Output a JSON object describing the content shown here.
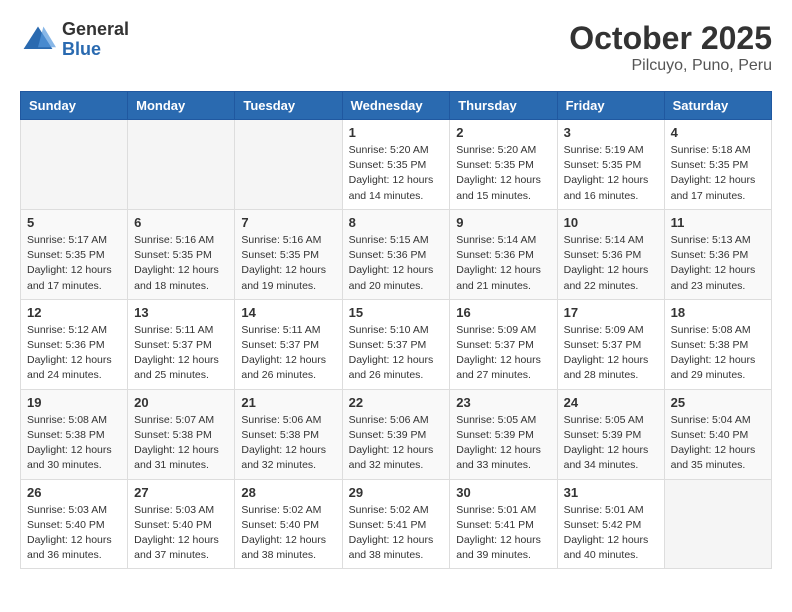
{
  "header": {
    "logo_general": "General",
    "logo_blue": "Blue",
    "month_title": "October 2025",
    "location": "Pilcuyo, Puno, Peru"
  },
  "weekdays": [
    "Sunday",
    "Monday",
    "Tuesday",
    "Wednesday",
    "Thursday",
    "Friday",
    "Saturday"
  ],
  "weeks": [
    [
      null,
      null,
      null,
      {
        "day": "1",
        "sunrise": "5:20 AM",
        "sunset": "5:35 PM",
        "daylight": "12 hours and 14 minutes."
      },
      {
        "day": "2",
        "sunrise": "5:20 AM",
        "sunset": "5:35 PM",
        "daylight": "12 hours and 15 minutes."
      },
      {
        "day": "3",
        "sunrise": "5:19 AM",
        "sunset": "5:35 PM",
        "daylight": "12 hours and 16 minutes."
      },
      {
        "day": "4",
        "sunrise": "5:18 AM",
        "sunset": "5:35 PM",
        "daylight": "12 hours and 17 minutes."
      }
    ],
    [
      {
        "day": "5",
        "sunrise": "5:17 AM",
        "sunset": "5:35 PM",
        "daylight": "12 hours and 17 minutes."
      },
      {
        "day": "6",
        "sunrise": "5:16 AM",
        "sunset": "5:35 PM",
        "daylight": "12 hours and 18 minutes."
      },
      {
        "day": "7",
        "sunrise": "5:16 AM",
        "sunset": "5:35 PM",
        "daylight": "12 hours and 19 minutes."
      },
      {
        "day": "8",
        "sunrise": "5:15 AM",
        "sunset": "5:36 PM",
        "daylight": "12 hours and 20 minutes."
      },
      {
        "day": "9",
        "sunrise": "5:14 AM",
        "sunset": "5:36 PM",
        "daylight": "12 hours and 21 minutes."
      },
      {
        "day": "10",
        "sunrise": "5:14 AM",
        "sunset": "5:36 PM",
        "daylight": "12 hours and 22 minutes."
      },
      {
        "day": "11",
        "sunrise": "5:13 AM",
        "sunset": "5:36 PM",
        "daylight": "12 hours and 23 minutes."
      }
    ],
    [
      {
        "day": "12",
        "sunrise": "5:12 AM",
        "sunset": "5:36 PM",
        "daylight": "12 hours and 24 minutes."
      },
      {
        "day": "13",
        "sunrise": "5:11 AM",
        "sunset": "5:37 PM",
        "daylight": "12 hours and 25 minutes."
      },
      {
        "day": "14",
        "sunrise": "5:11 AM",
        "sunset": "5:37 PM",
        "daylight": "12 hours and 26 minutes."
      },
      {
        "day": "15",
        "sunrise": "5:10 AM",
        "sunset": "5:37 PM",
        "daylight": "12 hours and 26 minutes."
      },
      {
        "day": "16",
        "sunrise": "5:09 AM",
        "sunset": "5:37 PM",
        "daylight": "12 hours and 27 minutes."
      },
      {
        "day": "17",
        "sunrise": "5:09 AM",
        "sunset": "5:37 PM",
        "daylight": "12 hours and 28 minutes."
      },
      {
        "day": "18",
        "sunrise": "5:08 AM",
        "sunset": "5:38 PM",
        "daylight": "12 hours and 29 minutes."
      }
    ],
    [
      {
        "day": "19",
        "sunrise": "5:08 AM",
        "sunset": "5:38 PM",
        "daylight": "12 hours and 30 minutes."
      },
      {
        "day": "20",
        "sunrise": "5:07 AM",
        "sunset": "5:38 PM",
        "daylight": "12 hours and 31 minutes."
      },
      {
        "day": "21",
        "sunrise": "5:06 AM",
        "sunset": "5:38 PM",
        "daylight": "12 hours and 32 minutes."
      },
      {
        "day": "22",
        "sunrise": "5:06 AM",
        "sunset": "5:39 PM",
        "daylight": "12 hours and 32 minutes."
      },
      {
        "day": "23",
        "sunrise": "5:05 AM",
        "sunset": "5:39 PM",
        "daylight": "12 hours and 33 minutes."
      },
      {
        "day": "24",
        "sunrise": "5:05 AM",
        "sunset": "5:39 PM",
        "daylight": "12 hours and 34 minutes."
      },
      {
        "day": "25",
        "sunrise": "5:04 AM",
        "sunset": "5:40 PM",
        "daylight": "12 hours and 35 minutes."
      }
    ],
    [
      {
        "day": "26",
        "sunrise": "5:03 AM",
        "sunset": "5:40 PM",
        "daylight": "12 hours and 36 minutes."
      },
      {
        "day": "27",
        "sunrise": "5:03 AM",
        "sunset": "5:40 PM",
        "daylight": "12 hours and 37 minutes."
      },
      {
        "day": "28",
        "sunrise": "5:02 AM",
        "sunset": "5:40 PM",
        "daylight": "12 hours and 38 minutes."
      },
      {
        "day": "29",
        "sunrise": "5:02 AM",
        "sunset": "5:41 PM",
        "daylight": "12 hours and 38 minutes."
      },
      {
        "day": "30",
        "sunrise": "5:01 AM",
        "sunset": "5:41 PM",
        "daylight": "12 hours and 39 minutes."
      },
      {
        "day": "31",
        "sunrise": "5:01 AM",
        "sunset": "5:42 PM",
        "daylight": "12 hours and 40 minutes."
      },
      null
    ]
  ]
}
